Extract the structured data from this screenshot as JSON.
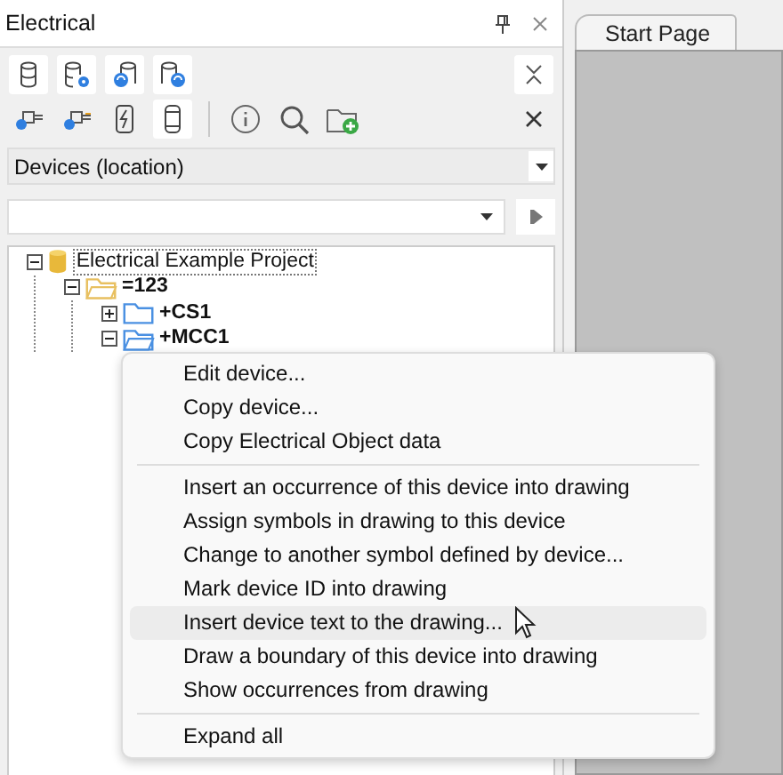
{
  "panel": {
    "title": "Electrical"
  },
  "location_dropdown": {
    "value": "Devices (location)"
  },
  "tree": [
    {
      "label": "Electrical Example Project",
      "kind": "project",
      "expanded": true,
      "children": [
        {
          "label": "=123",
          "kind": "function",
          "expanded": true,
          "children": [
            {
              "label": "+CS1",
              "kind": "location",
              "expanded": false
            },
            {
              "label": "+MCC1",
              "kind": "location",
              "expanded": true
            }
          ]
        }
      ]
    }
  ],
  "document_tabs": [
    {
      "label": "Start Page",
      "selected": true
    }
  ],
  "context_menu": {
    "sections": [
      [
        {
          "label": "Edit device...",
          "hovered": false
        },
        {
          "label": "Copy device...",
          "hovered": false
        },
        {
          "label": "Copy Electrical Object data",
          "hovered": false
        }
      ],
      [
        {
          "label": "Insert an occurrence of this device into drawing",
          "hovered": false
        },
        {
          "label": "Assign symbols in drawing to this device",
          "hovered": false
        },
        {
          "label": "Change to another symbol defined by device...",
          "hovered": false
        },
        {
          "label": "Mark device ID into drawing",
          "hovered": false
        },
        {
          "label": "Insert device text to the drawing...",
          "hovered": true
        },
        {
          "label": "Draw a boundary of this device into drawing",
          "hovered": false
        },
        {
          "label": "Show occurrences from drawing",
          "hovered": false
        }
      ],
      [
        {
          "label": "Expand all",
          "hovered": false
        }
      ]
    ]
  }
}
